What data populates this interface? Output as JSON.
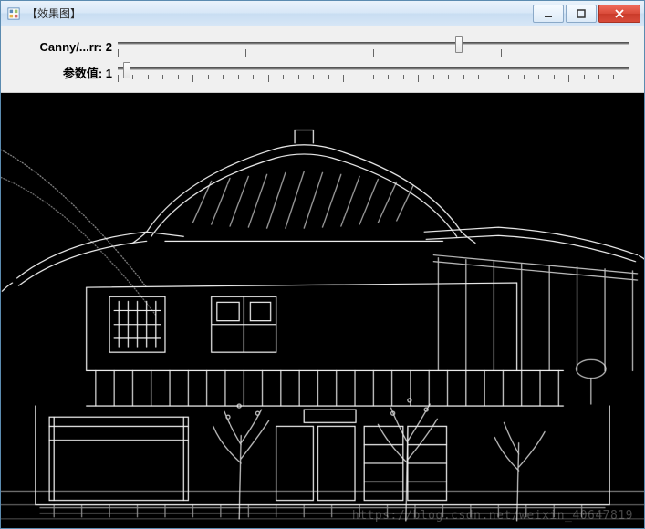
{
  "window": {
    "title": "【效果图】"
  },
  "controls": {
    "slider1": {
      "label": "Canny/...rr: 2",
      "value": 2,
      "min": 0,
      "max": 3,
      "thumb_pct": 66
    },
    "slider2": {
      "label": "参数值: 1",
      "value": 1,
      "min": 0,
      "max": 255,
      "thumb_pct": 1
    }
  },
  "watermark": "https://blog.csdn.net/weixin_40647819",
  "image": {
    "description": "Canny edge-detection output of a two-story traditional Chinese building with tiled upturned roofs, balcony railing, trees in front; white edges on black."
  }
}
